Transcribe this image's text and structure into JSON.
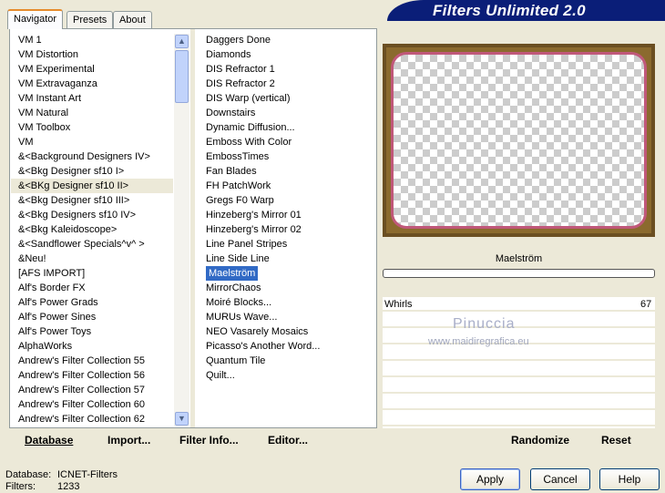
{
  "title": "Filters Unlimited 2.0",
  "tabs": [
    "Navigator",
    "Presets",
    "About"
  ],
  "categories": [
    "VM 1",
    "VM Distortion",
    "VM Experimental",
    "VM Extravaganza",
    "VM Instant Art",
    "VM Natural",
    "VM Toolbox",
    "VM",
    "&<Background Designers IV>",
    "&<Bkg Designer sf10 I>",
    "&<BKg Designer sf10 II>",
    "&<Bkg Designer sf10 III>",
    "&<Bkg Designers sf10 IV>",
    "&<Bkg Kaleidoscope>",
    "&<Sandflower Specials^v^ >",
    "&Neu!",
    "[AFS IMPORT]",
    "Alf's Border FX",
    "Alf's Power Grads",
    "Alf's Power Sines",
    "Alf's Power Toys",
    "AlphaWorks",
    "Andrew's Filter Collection 55",
    "Andrew's Filter Collection 56",
    "Andrew's Filter Collection 57",
    "Andrew's Filter Collection 60",
    "Andrew's Filter Collection 62"
  ],
  "selected_category": "&<BKg Designer sf10 II>",
  "filters": [
    "Daggers Done",
    "Diamonds",
    "DIS Refractor 1",
    "DIS Refractor 2",
    "DIS Warp (vertical)",
    "Downstairs",
    "Dynamic Diffusion...",
    "Emboss With Color",
    "EmbossTimes",
    "Fan Blades",
    "FH PatchWork",
    "Gregs F0 Warp",
    "Hinzeberg's Mirror 01",
    "Hinzeberg's Mirror 02",
    "Line Panel Stripes",
    "Line Side Line",
    "Maelström",
    "MirrorChaos",
    "Moiré Blocks...",
    "MURUs Wave...",
    "NEO Vasarely Mosaics",
    "Picasso's Another Word...",
    "Quantum Tile",
    "Quilt..."
  ],
  "selected_filter": "Maelström",
  "params": {
    "filter_name": "Maelström",
    "sliders": [
      {
        "label": "Whirls",
        "value": 67,
        "max": 255
      }
    ]
  },
  "watermark": {
    "name": "Pinuccia",
    "url": "www.maidiregrafica.eu"
  },
  "buttons": {
    "database": "Database",
    "import": "Import...",
    "filter_info": "Filter Info...",
    "editor": "Editor...",
    "randomize": "Randomize",
    "reset": "Reset",
    "apply": "Apply",
    "cancel": "Cancel",
    "help": "Help"
  },
  "status": {
    "database_label": "Database:",
    "database_value": "ICNET-Filters",
    "filters_label": "Filters:",
    "filters_value": "1233"
  }
}
